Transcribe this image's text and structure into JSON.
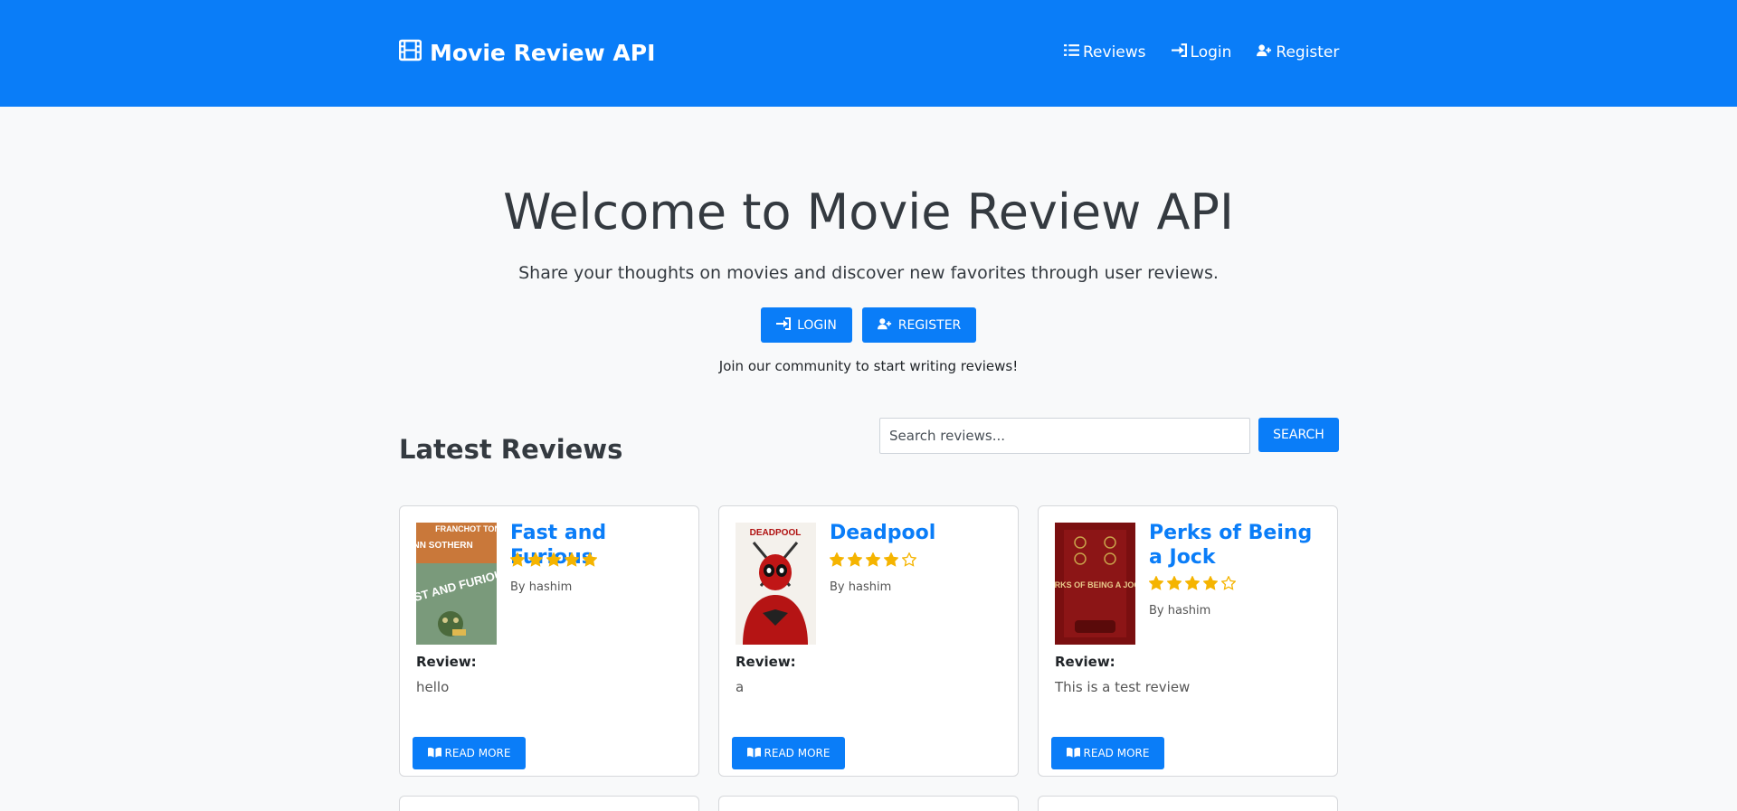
{
  "navbar": {
    "brand": "Movie Review API",
    "links": [
      {
        "label": "Reviews",
        "icon": "list-icon"
      },
      {
        "label": "Login",
        "icon": "sign-in-icon"
      },
      {
        "label": "Register",
        "icon": "user-plus-icon"
      }
    ],
    "color": "#0a7df8"
  },
  "hero": {
    "title": "Welcome to Movie Review API",
    "subtitle": "Share your thoughts on movies and discover new favorites through user reviews.",
    "login_label": "Login",
    "register_label": "Register",
    "join_text": "Join our community to start writing reviews!"
  },
  "reviews_section": {
    "heading": "Latest Reviews",
    "search_placeholder": "Search reviews...",
    "search_label": "Search"
  },
  "cards": [
    {
      "title": "Fast and Furious",
      "rating": 5,
      "max_rating": 5,
      "author": "By hashim",
      "review_label": "Review:",
      "review_text": "hello",
      "read_more": "Read More"
    },
    {
      "title": "Deadpool",
      "rating": 4,
      "max_rating": 5,
      "author": "By hashim",
      "review_label": "Review:",
      "review_text": "a",
      "read_more": "Read More"
    },
    {
      "title": "Perks of Being a Jock",
      "rating": 4,
      "max_rating": 5,
      "author": "By hashim",
      "review_label": "Review:",
      "review_text": "This is a test review",
      "read_more": "Read More"
    }
  ],
  "poster_text": {
    "fast_top": "FRANCHOT TONE",
    "fast_mid": "ANN SOTHERN",
    "fast_main": "FAST AND FURIOUS",
    "deadpool_top": "DEADPOOL",
    "perks_main": "PERKS OF BEING A JOCK"
  },
  "star_color": "#f5b400"
}
